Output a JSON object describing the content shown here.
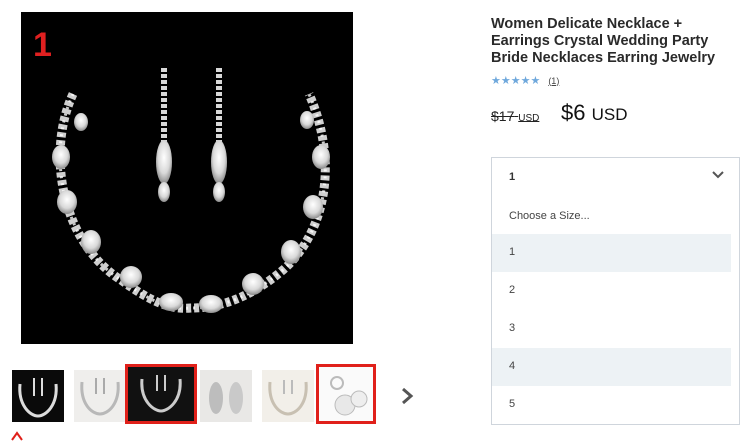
{
  "product": {
    "title": "Women Delicate Necklace + Earrings Crystal Wedding Party Bride Necklaces Earring Jewelry",
    "rating_stars": "★★★★★",
    "review_count": "(1)",
    "old_price": "$17",
    "old_currency": "USD",
    "new_price": "$6",
    "new_currency": "USD"
  },
  "main_image": {
    "number_label": "1"
  },
  "size_dropdown": {
    "selected_value": "1",
    "placeholder": "Choose a Size...",
    "options": [
      "1",
      "2",
      "3",
      "4",
      "5"
    ]
  },
  "thumbnails": [
    {
      "name": "necklace-set-black"
    },
    {
      "name": "necklace-set-light"
    },
    {
      "name": "necklace-set-dark-highlighted",
      "highlighted": true
    },
    {
      "name": "earrings-light"
    },
    {
      "name": "necklace-set-beige"
    },
    {
      "name": "pearl-earrings-highlighted",
      "highlighted": true
    }
  ],
  "colors": {
    "highlight": "#e0201a",
    "stars": "#6fa8dc",
    "option_shade": "#edf2f5",
    "number_label": "#e02020"
  }
}
